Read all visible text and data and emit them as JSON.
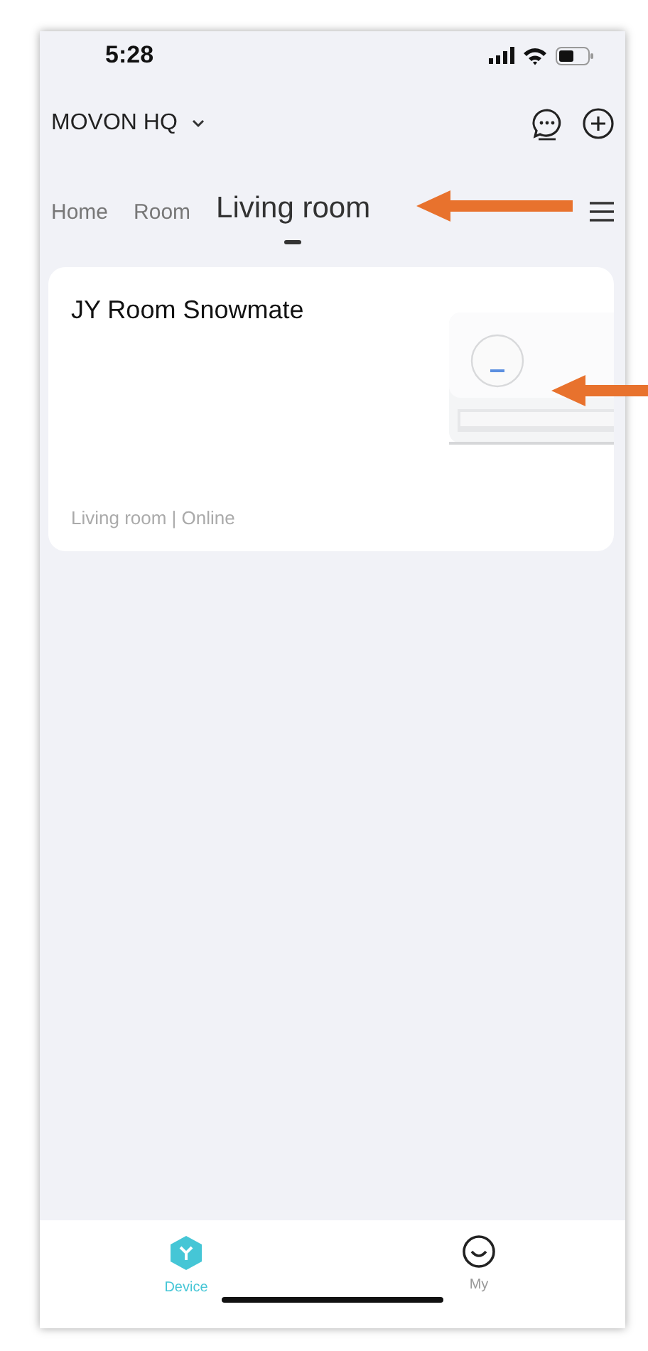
{
  "status_bar": {
    "time": "5:28"
  },
  "header": {
    "home_name": "MOVON HQ"
  },
  "room_tabs": [
    {
      "label": "Home",
      "selected": false
    },
    {
      "label": "Room",
      "selected": false
    },
    {
      "label": "Living room",
      "selected": true
    }
  ],
  "devices": [
    {
      "name": "JY Room Snowmate",
      "status": "Living room | Online",
      "kind": "picture"
    }
  ],
  "bottom_nav": [
    {
      "label": "Device",
      "kind": "device",
      "selected": true
    },
    {
      "label": "My",
      "kind": "my",
      "selected": false
    }
  ]
}
